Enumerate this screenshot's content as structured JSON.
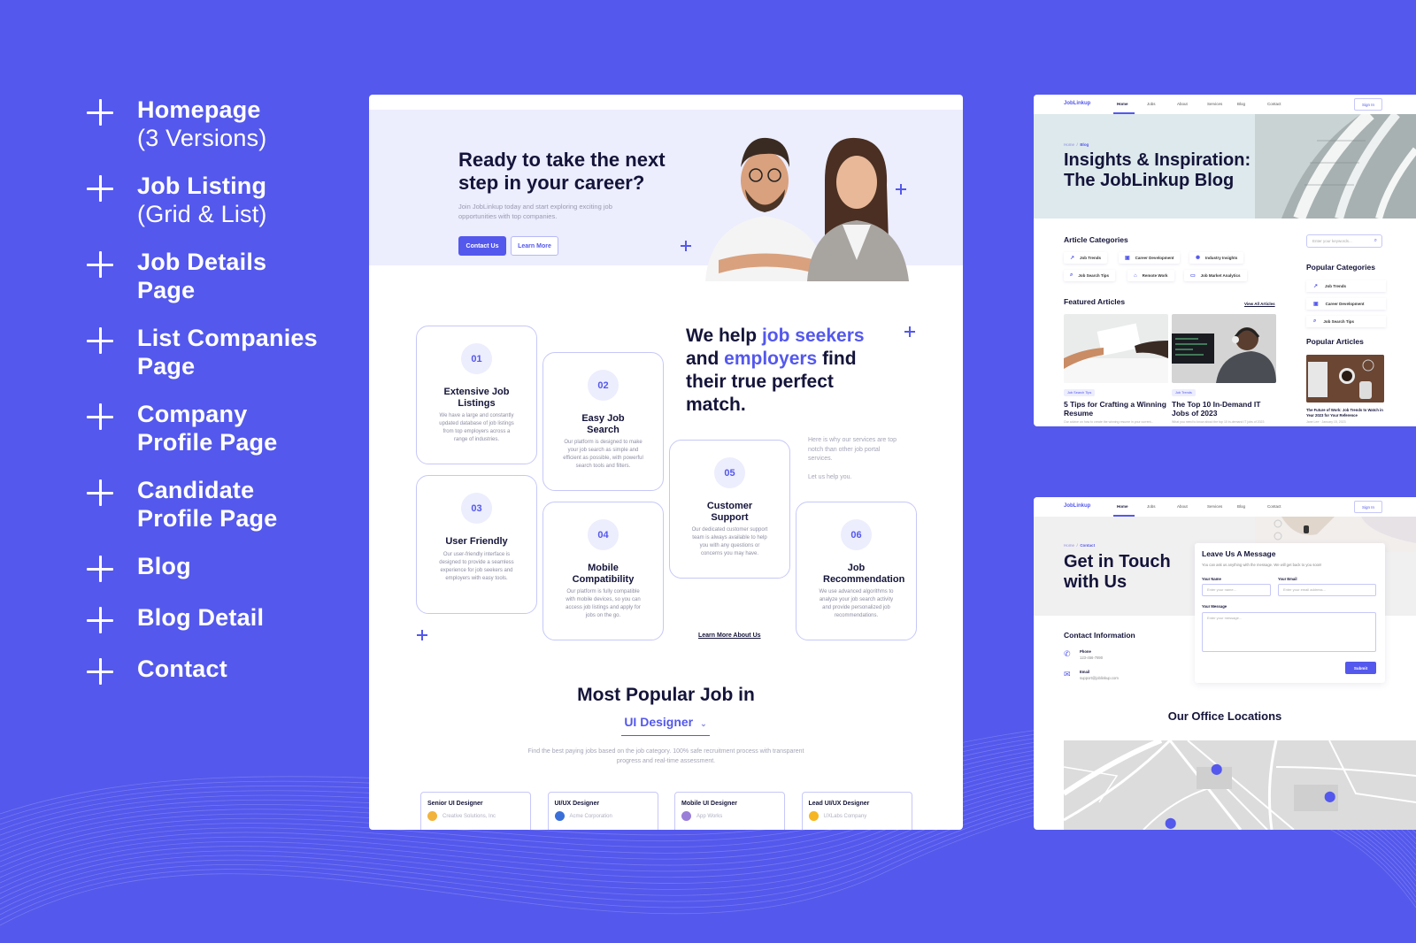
{
  "features": [
    {
      "title": "Homepage",
      "subtitle": "(3 Versions)"
    },
    {
      "title": "Job Listing",
      "subtitle": "(Grid & List)"
    },
    {
      "title": "Job Details",
      "subtitle": "Page",
      "subtitle_bold": true
    },
    {
      "title": "List Companies",
      "subtitle": "Page",
      "subtitle_bold": true
    },
    {
      "title": "Company",
      "subtitle": "Profile Page",
      "subtitle_bold": true
    },
    {
      "title": "Candidate",
      "subtitle": "Profile Page",
      "subtitle_bold": true
    },
    {
      "title": "Blog"
    },
    {
      "title": "Blog Detail"
    },
    {
      "title": "Contact"
    }
  ],
  "homepage": {
    "hero": {
      "title": "Ready to take the next step in your career?",
      "subtitle": "Join JobLinkup today and start exploring exciting job opportunities with top companies.",
      "primary_button": "Contact Us",
      "secondary_button": "Learn More"
    },
    "help": {
      "title_parts": [
        "We help ",
        "job seekers",
        " and ",
        "employers",
        " find their true perfect match."
      ],
      "description": "Here is why our services are top notch than other job portal services.",
      "cta": "Let us help you.",
      "learn_more": "Learn More About Us"
    },
    "services": [
      {
        "num": "01",
        "title": "Extensive Job Listings",
        "desc": "We have a large and constantly updated database of job listings from top employers across a range of industries."
      },
      {
        "num": "02",
        "title": "Easy Job Search",
        "desc": "Our platform is designed to make your job search as simple and efficient as possible, with powerful search tools and filters."
      },
      {
        "num": "03",
        "title": "User Friendly",
        "desc": "Our user-friendly interface is designed to provide a seamless experience for job seekers and employers with easy tools."
      },
      {
        "num": "04",
        "title": "Mobile Compatibility",
        "desc": "Our platform is fully compatible with mobile devices, so you can access job listings and apply for jobs on the go."
      },
      {
        "num": "05",
        "title": "Customer Support",
        "desc": "Our dedicated customer support team is always available to help you with any questions or concerns you may have."
      },
      {
        "num": "06",
        "title": "Job Recommendation",
        "desc": "We use advanced algorithms to analyze your job search activity and provide personalized job recommendations."
      }
    ],
    "popular": {
      "title": "Most Popular Job in",
      "selected_category": "UI Designer",
      "description": "Find the best paying jobs based on the job category. 100% safe recruitment process with transparent progress and real-time assessment.",
      "jobs": [
        {
          "title": "Senior UI Designer",
          "company": "Creative Solutions, Inc",
          "logo_color": "#f2b33d"
        },
        {
          "title": "UI/UX Designer",
          "company": "Acme Corporation",
          "logo_color": "#3b6fd8"
        },
        {
          "title": "Mobile UI Designer",
          "company": "App Works",
          "logo_color": "#9a7fd8"
        },
        {
          "title": "Lead UI/UX Designer",
          "company": "UXLabs Company",
          "logo_color": "#f5b621"
        }
      ]
    }
  },
  "mini_nav": {
    "logo": "JobLinkup",
    "items": [
      "Home",
      "Jobs",
      "About",
      "Services",
      "Blog",
      "Contact"
    ],
    "active": "Home",
    "sign_in": "Sign In"
  },
  "blog": {
    "breadcrumb": {
      "home": "Home",
      "separator": "/",
      "current": "Blog"
    },
    "title": "Insights & Inspiration: The JobLinkup Blog",
    "categories_heading": "Article Categories",
    "categories": [
      {
        "icon": "trend-icon",
        "glyph": "↗",
        "label": "Job Trends"
      },
      {
        "icon": "briefcase-icon",
        "glyph": "▣",
        "label": "Career Development"
      },
      {
        "icon": "lightbulb-icon",
        "glyph": "✺",
        "label": "Industry Insights"
      },
      {
        "icon": "search-icon",
        "glyph": "⌕",
        "label": "Job Search Tips"
      },
      {
        "icon": "home-icon",
        "glyph": "⌂",
        "label": "Remote Work"
      },
      {
        "icon": "monitor-icon",
        "glyph": "▭",
        "label": "Job Market Analytics"
      }
    ],
    "featured_heading": "Featured Articles",
    "view_all": "View All Articles",
    "featured": [
      {
        "tag": "Job Search Tips",
        "title": "5 Tips for Crafting a Winning Resume",
        "excerpt": "Our advice on how to create the winning resume in your current..."
      },
      {
        "tag": "Job Trends",
        "title": "The Top 10 In-Demand IT Jobs of 2023",
        "excerpt": "What you need to know about the top 10 in-demand IT jobs of 2023"
      }
    ],
    "search_placeholder": "Enter your keywords...",
    "popular_categories_heading": "Popular Categories",
    "popular_categories": [
      {
        "glyph": "↗",
        "label": "Job Trends"
      },
      {
        "glyph": "▣",
        "label": "Career Development"
      },
      {
        "glyph": "⌕",
        "label": "Job Search Tips"
      }
    ],
    "popular_articles_heading": "Popular Articles",
    "popular_article": {
      "title": "The Future of Work: Job Trends to Watch in Year 2023 for Your Reference",
      "meta": "Jane Lee · January 15, 2023"
    }
  },
  "contact": {
    "breadcrumb": {
      "home": "Home",
      "separator": "/",
      "current": "Contact"
    },
    "title": "Get in Touch with Us",
    "form": {
      "heading": "Leave Us A Message",
      "subheading": "You can ask us anything with the message. We will get back to you soon!",
      "name_label": "Your Name",
      "name_placeholder": "Enter your name...",
      "email_label": "Your Email",
      "email_placeholder": "Enter your email address...",
      "message_label": "Your Message",
      "message_placeholder": "Enter your message...",
      "submit": "Submit"
    },
    "info_heading": "Contact Information",
    "phone_label": "Phone",
    "phone": "123-456-7890",
    "email_label": "Email",
    "email": "support@joblinkup.com",
    "office_heading": "Our Office Locations"
  },
  "colors": {
    "brand": "#5458ec",
    "dark": "#14143a",
    "hero_tint": "#ecedfd"
  }
}
